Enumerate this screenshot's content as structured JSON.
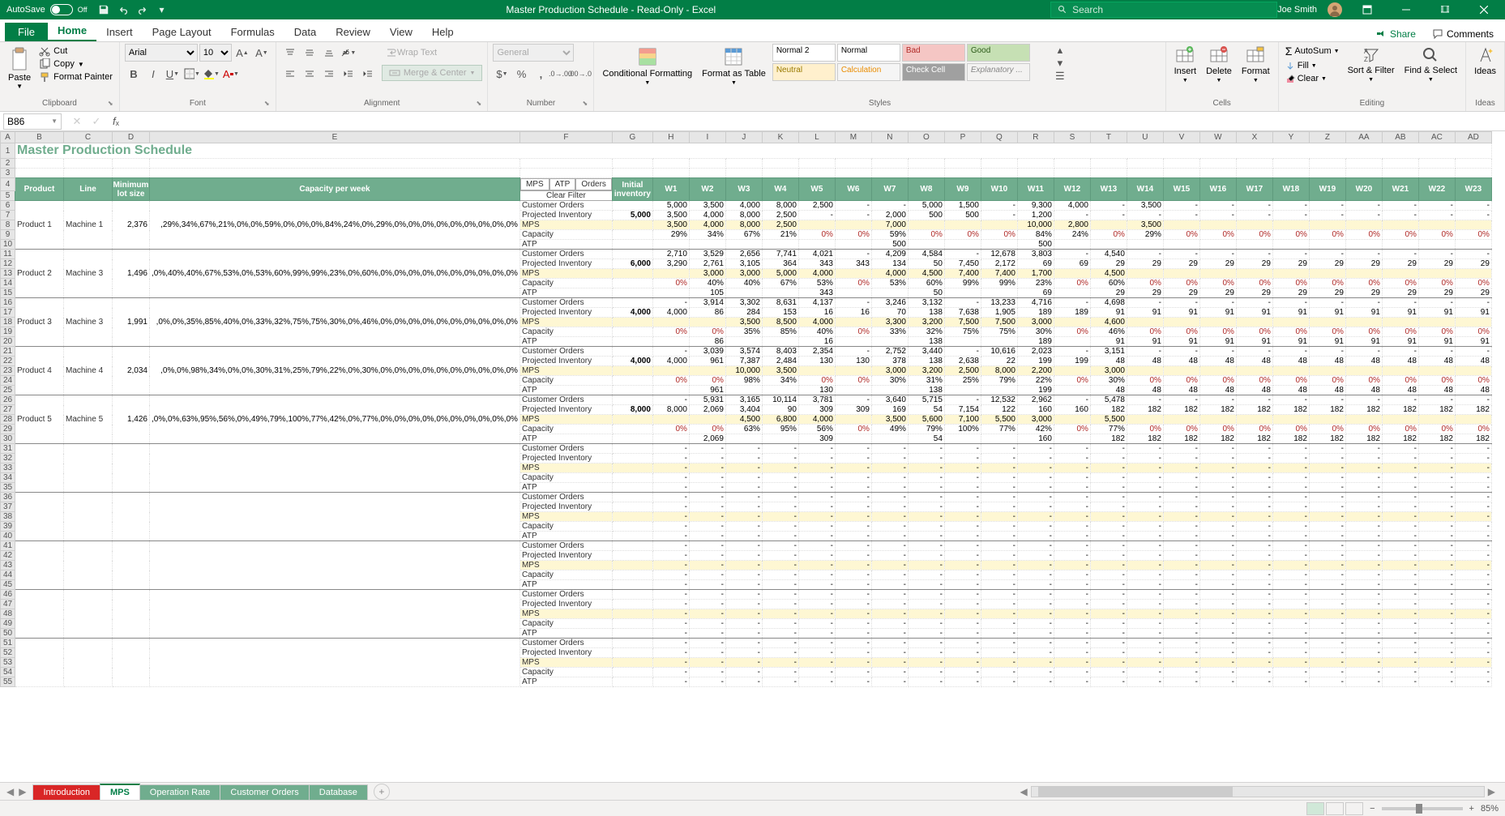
{
  "title_bar": {
    "autosave_label": "AutoSave",
    "autosave_state": "Off",
    "doc_title": "Master Production Schedule - Read-Only - Excel",
    "search_placeholder": "Search",
    "user_name": "Joe Smith"
  },
  "menu": {
    "file": "File",
    "home": "Home",
    "insert": "Insert",
    "page_layout": "Page Layout",
    "formulas": "Formulas",
    "data": "Data",
    "review": "Review",
    "view": "View",
    "help": "Help",
    "share": "Share",
    "comments": "Comments"
  },
  "ribbon": {
    "clipboard": {
      "paste": "Paste",
      "cut": "Cut",
      "copy": "Copy",
      "format_painter": "Format Painter",
      "label": "Clipboard"
    },
    "font": {
      "name": "Arial",
      "size": "10",
      "label": "Font"
    },
    "alignment": {
      "wrap": "Wrap Text",
      "merge": "Merge & Center",
      "label": "Alignment"
    },
    "number": {
      "format": "General",
      "label": "Number"
    },
    "styles": {
      "cond": "Conditional Formatting",
      "table": "Format as Table",
      "normal2": "Normal 2",
      "normal": "Normal",
      "bad": "Bad",
      "good": "Good",
      "neutral": "Neutral",
      "calc": "Calculation",
      "check": "Check Cell",
      "explan": "Explanatory ...",
      "label": "Styles"
    },
    "cells": {
      "insert": "Insert",
      "delete": "Delete",
      "format": "Format",
      "label": "Cells"
    },
    "editing": {
      "autosum": "AutoSum",
      "fill": "Fill",
      "clear": "Clear",
      "sort": "Sort & Filter",
      "find": "Find & Select",
      "label": "Editing"
    },
    "ideas": {
      "ideas": "Ideas",
      "label": "Ideas"
    }
  },
  "formula_bar": {
    "name_box": "B86",
    "formula": ""
  },
  "sheet": {
    "title": "Master Production Schedule",
    "headers": {
      "product": "Product",
      "line": "Line",
      "min_lot": "Minimum lot size",
      "capacity": "Capacity per week",
      "init_inv": "Initial inventory",
      "filters": {
        "mps": "MPS",
        "atp": "ATP",
        "orders": "Orders",
        "clear": "Clear Filter"
      }
    },
    "week_cols": [
      "W1",
      "W2",
      "W3",
      "W4",
      "W5",
      "W6",
      "W7",
      "W8",
      "W9",
      "W10",
      "W11",
      "W12",
      "W13",
      "W14",
      "W15",
      "W16",
      "W17",
      "W18",
      "W19",
      "W20",
      "W21",
      "W22",
      "W23"
    ],
    "col_letters": [
      "A",
      "B",
      "C",
      "D",
      "E",
      "F",
      "G",
      "H",
      "I",
      "J",
      "K",
      "L",
      "M",
      "N",
      "O",
      "P",
      "Q",
      "R",
      "S",
      "T",
      "U",
      "V",
      "W",
      "X",
      "Y",
      "Z",
      "AA",
      "AB",
      "AC",
      "AD"
    ],
    "row_labels": {
      "co": "Customer Orders",
      "pi": "Projected Inventory",
      "mps": "MPS",
      "cap": "Capacity",
      "atp": "ATP"
    },
    "products": [
      {
        "name": "Product 1",
        "line": "Machine 1",
        "min_lot": "2,376",
        "cap": [
          "",
          "29%",
          "34%",
          "67%",
          "21%",
          "0%",
          "0%",
          "59%",
          "0%",
          "0%",
          "0%",
          "84%",
          "24%",
          "0%",
          "29%",
          "0%",
          "0%",
          "0%",
          "0%",
          "0%",
          "0%",
          "0%",
          "0%",
          "0%"
        ],
        "init": "5,000",
        "co": [
          "-",
          "5,000",
          "3,500",
          "4,000",
          "8,000",
          "2,500",
          "-",
          "-",
          "5,000",
          "1,500",
          "-",
          "9,300",
          "4,000",
          "-",
          "3,500",
          "-",
          "-",
          "-",
          "-",
          "-",
          "-",
          "-",
          "-",
          "-"
        ],
        "pi": [
          "",
          "3,500",
          "4,000",
          "8,000",
          "2,500",
          "-",
          "-",
          "2,000",
          "500",
          "500",
          "-",
          "1,200",
          "-",
          "-",
          "-",
          "-",
          "-",
          "-",
          "-",
          "-",
          "-",
          "-",
          "-",
          "-"
        ],
        "mps": [
          "",
          "3,500",
          "4,000",
          "8,000",
          "2,500",
          "",
          "",
          "7,000",
          "",
          "",
          "",
          "10,000",
          "2,800",
          "",
          "3,500",
          "",
          "",
          "",
          "",
          "",
          "",
          "",
          "",
          ""
        ],
        "atp": [
          "",
          "",
          "",
          "",
          "",
          "",
          "",
          "500",
          "",
          "",
          "",
          "500",
          "",
          "",
          "",
          "",
          "",
          "",
          "",
          "",
          "",
          "",
          "",
          ""
        ]
      },
      {
        "name": "Product 2",
        "line": "Machine 3",
        "min_lot": "1,496",
        "cap": [
          "",
          "0%",
          "40%",
          "40%",
          "67%",
          "53%",
          "0%",
          "53%",
          "60%",
          "99%",
          "99%",
          "23%",
          "0%",
          "60%",
          "0%",
          "0%",
          "0%",
          "0%",
          "0%",
          "0%",
          "0%",
          "0%",
          "0%",
          "0%"
        ],
        "init": "6,000",
        "co": [
          "",
          "2,710",
          "3,529",
          "2,656",
          "7,741",
          "4,021",
          "-",
          "4,209",
          "4,584",
          "-",
          "12,678",
          "3,803",
          "-",
          "4,540",
          "-",
          "-",
          "-",
          "-",
          "-",
          "-",
          "-",
          "-",
          "-",
          "-"
        ],
        "pi": [
          "",
          "3,290",
          "2,761",
          "3,105",
          "364",
          "343",
          "343",
          "134",
          "50",
          "7,450",
          "2,172",
          "69",
          "69",
          "29",
          "29",
          "29",
          "29",
          "29",
          "29",
          "29",
          "29",
          "29",
          "29",
          "29"
        ],
        "mps": [
          "",
          "",
          "3,000",
          "3,000",
          "5,000",
          "4,000",
          "",
          "4,000",
          "4,500",
          "7,400",
          "7,400",
          "1,700",
          "",
          "4,500",
          "",
          "",
          "",
          "",
          "",
          "",
          "",
          "",
          "",
          ""
        ],
        "atp": [
          "",
          "",
          "105",
          "",
          "",
          "343",
          "",
          "",
          "50",
          "",
          "",
          "69",
          "",
          "29",
          "29",
          "29",
          "29",
          "29",
          "29",
          "29",
          "29",
          "29",
          "29",
          "29"
        ]
      },
      {
        "name": "Product 3",
        "line": "Machine 3",
        "min_lot": "1,991",
        "cap": [
          "",
          "0%",
          "0%",
          "35%",
          "85%",
          "40%",
          "0%",
          "33%",
          "32%",
          "75%",
          "75%",
          "30%",
          "0%",
          "46%",
          "0%",
          "0%",
          "0%",
          "0%",
          "0%",
          "0%",
          "0%",
          "0%",
          "0%",
          "0%"
        ],
        "init": "4,000",
        "co": [
          "",
          "-",
          "3,914",
          "3,302",
          "8,631",
          "4,137",
          "-",
          "3,246",
          "3,132",
          "-",
          "13,233",
          "4,716",
          "-",
          "4,698",
          "-",
          "-",
          "-",
          "-",
          "-",
          "-",
          "-",
          "-",
          "-",
          "-"
        ],
        "pi": [
          "",
          "4,000",
          "86",
          "284",
          "153",
          "16",
          "16",
          "70",
          "138",
          "7,638",
          "1,905",
          "189",
          "189",
          "91",
          "91",
          "91",
          "91",
          "91",
          "91",
          "91",
          "91",
          "91",
          "91",
          "91"
        ],
        "mps": [
          "",
          "",
          "",
          "3,500",
          "8,500",
          "4,000",
          "",
          "3,300",
          "3,200",
          "7,500",
          "7,500",
          "3,000",
          "",
          "4,600",
          "",
          "",
          "",
          "",
          "",
          "",
          "",
          "",
          "",
          ""
        ],
        "atp": [
          "",
          "",
          "86",
          "",
          "",
          "16",
          "",
          "",
          "138",
          "",
          "",
          "189",
          "",
          "91",
          "91",
          "91",
          "91",
          "91",
          "91",
          "91",
          "91",
          "91",
          "91",
          "91"
        ]
      },
      {
        "name": "Product 4",
        "line": "Machine 4",
        "min_lot": "2,034",
        "cap": [
          "",
          "0%",
          "0%",
          "98%",
          "34%",
          "0%",
          "0%",
          "30%",
          "31%",
          "25%",
          "79%",
          "22%",
          "0%",
          "30%",
          "0%",
          "0%",
          "0%",
          "0%",
          "0%",
          "0%",
          "0%",
          "0%",
          "0%",
          "0%"
        ],
        "init": "4,000",
        "co": [
          "",
          "-",
          "3,039",
          "3,574",
          "8,403",
          "2,354",
          "-",
          "2,752",
          "3,440",
          "-",
          "10,616",
          "2,023",
          "-",
          "3,151",
          "-",
          "-",
          "-",
          "-",
          "-",
          "-",
          "-",
          "-",
          "-",
          "-"
        ],
        "pi": [
          "",
          "4,000",
          "961",
          "7,387",
          "2,484",
          "130",
          "130",
          "378",
          "138",
          "2,638",
          "22",
          "199",
          "199",
          "48",
          "48",
          "48",
          "48",
          "48",
          "48",
          "48",
          "48",
          "48",
          "48",
          "48"
        ],
        "mps": [
          "",
          "",
          "",
          "10,000",
          "3,500",
          "",
          "",
          "3,000",
          "3,200",
          "2,500",
          "8,000",
          "2,200",
          "",
          "3,000",
          "",
          "",
          "",
          "",
          "",
          "",
          "",
          "",
          "",
          ""
        ],
        "atp": [
          "",
          "",
          "961",
          "",
          "",
          "130",
          "",
          "",
          "138",
          "",
          "",
          "199",
          "",
          "48",
          "48",
          "48",
          "48",
          "48",
          "48",
          "48",
          "48",
          "48",
          "48",
          "48"
        ]
      },
      {
        "name": "Product 5",
        "line": "Machine 5",
        "min_lot": "1,426",
        "cap": [
          "",
          "0%",
          "0%",
          "63%",
          "95%",
          "56%",
          "0%",
          "49%",
          "79%",
          "100%",
          "77%",
          "42%",
          "0%",
          "77%",
          "0%",
          "0%",
          "0%",
          "0%",
          "0%",
          "0%",
          "0%",
          "0%",
          "0%",
          "0%"
        ],
        "init": "8,000",
        "co": [
          "",
          "-",
          "5,931",
          "3,165",
          "10,114",
          "3,781",
          "-",
          "3,640",
          "5,715",
          "-",
          "12,532",
          "2,962",
          "-",
          "5,478",
          "-",
          "-",
          "-",
          "-",
          "-",
          "-",
          "-",
          "-",
          "-",
          "-"
        ],
        "pi": [
          "",
          "8,000",
          "2,069",
          "3,404",
          "90",
          "309",
          "309",
          "169",
          "54",
          "7,154",
          "122",
          "160",
          "160",
          "182",
          "182",
          "182",
          "182",
          "182",
          "182",
          "182",
          "182",
          "182",
          "182",
          "182"
        ],
        "mps": [
          "",
          "",
          "",
          "4,500",
          "6,800",
          "4,000",
          "",
          "3,500",
          "5,600",
          "7,100",
          "5,500",
          "3,000",
          "",
          "5,500",
          "",
          "",
          "",
          "",
          "",
          "",
          "",
          "",
          "",
          ""
        ],
        "atp": [
          "",
          "",
          "2,069",
          "",
          "",
          "309",
          "",
          "",
          "54",
          "",
          "",
          "160",
          "",
          "182",
          "182",
          "182",
          "182",
          "182",
          "182",
          "182",
          "182",
          "182",
          "182",
          "182"
        ]
      }
    ],
    "empty_block_count": 5
  },
  "sheet_tabs": [
    "Introduction",
    "MPS",
    "Operation Rate",
    "Customer Orders",
    "Database"
  ],
  "active_tab": "MPS",
  "status": {
    "zoom": "85%"
  }
}
